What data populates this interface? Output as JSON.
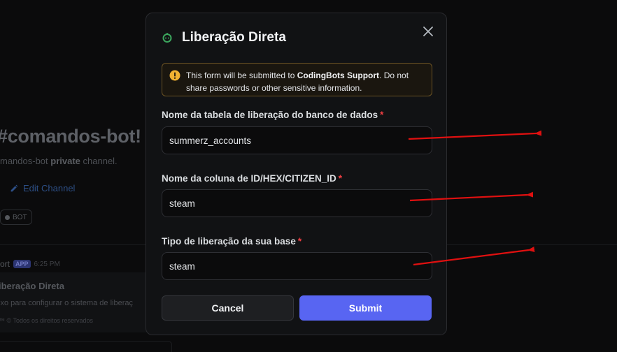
{
  "background": {
    "channel_title": "#comandos-bot!",
    "channel_sub_prefix": "mandos-bot ",
    "channel_sub_bold": "private",
    "channel_sub_suffix": " channel.",
    "edit_channel": "Edit Channel",
    "bot_tag": "BOT",
    "author": "ort",
    "app_badge": "APP",
    "time": "6:25 PM",
    "embed_title": "iberação Direta",
    "embed_desc": "ixo para configurar o sistema de liberaç",
    "embed_footer": "™ © Todos os direitos reservados"
  },
  "modal": {
    "title": "Liberação Direta",
    "icon": "bot-app-icon",
    "warning": {
      "prefix": "This form will be submitted to ",
      "bold": "CodingBots Support",
      "suffix": ". Do not share passwords or other sensitive information."
    },
    "fields": [
      {
        "label": "Nome da tabela de liberação do banco de dados",
        "required": "*",
        "value": "summerz_accounts"
      },
      {
        "label": "Nome da coluna de ID/HEX/CITIZEN_ID",
        "required": "*",
        "value": "steam"
      },
      {
        "label": "Tipo de liberação da sua base",
        "required": "*",
        "value": "steam"
      }
    ],
    "cancel_label": "Cancel",
    "submit_label": "Submit"
  },
  "colors": {
    "accent": "#5865f2",
    "warning_border": "#6b5324",
    "annotation_arrow": "#e01010",
    "required": "#f23f43"
  }
}
